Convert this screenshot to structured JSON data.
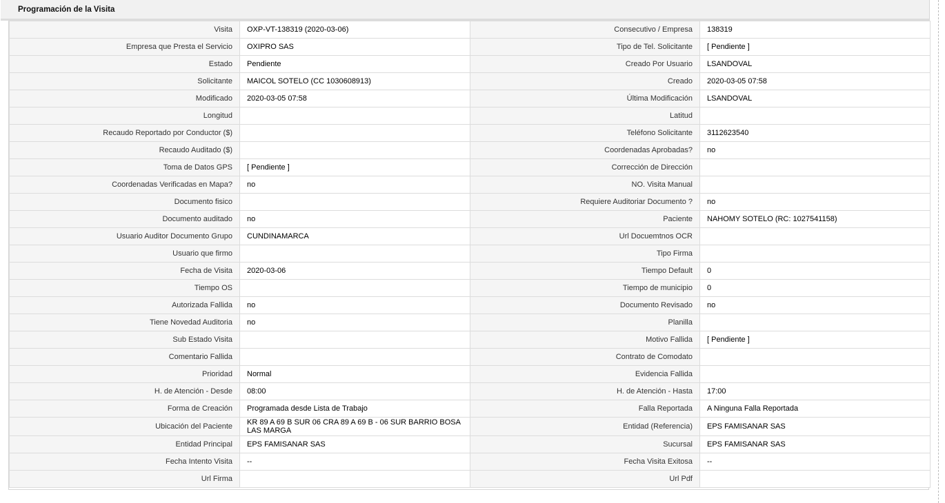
{
  "section_title": "Programación de la Visita",
  "rows": [
    {
      "l1": "Visita",
      "v1": "OXP-VT-138319 (2020-03-06)",
      "l2": "Consecutivo / Empresa",
      "v2": "138319"
    },
    {
      "l1": "Empresa que Presta el Servicio",
      "v1": "OXIPRO SAS",
      "l2": "Tipo de Tel. Solicitante",
      "v2": "[ Pendiente ]"
    },
    {
      "l1": "Estado",
      "v1": "Pendiente",
      "l2": "Creado Por Usuario",
      "v2": "LSANDOVAL"
    },
    {
      "l1": "Solicitante",
      "v1": "MAICOL SOTELO (CC 1030608913)",
      "l2": "Creado",
      "v2": "2020-03-05 07:58"
    },
    {
      "l1": "Modificado",
      "v1": "2020-03-05 07:58",
      "l2": "Última Modificación",
      "v2": " LSANDOVAL"
    },
    {
      "l1": "Longitud",
      "v1": "",
      "l2": "Latitud",
      "v2": ""
    },
    {
      "l1": "Recaudo Reportado por Conductor ($)",
      "v1": "",
      "l2": "Teléfono Solicitante",
      "v2": "3112623540"
    },
    {
      "l1": "Recaudo Auditado ($)",
      "v1": "",
      "l2": "Coordenadas Aprobadas?",
      "v2": " no"
    },
    {
      "l1": "Toma de Datos GPS",
      "v1": "[ Pendiente ]",
      "l2": "Corrección de Dirección",
      "v2": ""
    },
    {
      "l1": "Coordenadas Verificadas en Mapa?",
      "v1": " no",
      "l2": "NO. Visita Manual",
      "v2": ""
    },
    {
      "l1": "Documento fisico",
      "v1": "",
      "l2": "Requiere Auditoriar Documento ?",
      "v2": " no"
    },
    {
      "l1": "Documento auditado",
      "v1": " no",
      "l2": "Paciente",
      "v2": "NAHOMY SOTELO (RC: 1027541158)"
    },
    {
      "l1": "Usuario Auditor Documento Grupo",
      "v1": "CUNDINAMARCA",
      "l2": "Url Docuemtnos OCR",
      "v2": ""
    },
    {
      "l1": "Usuario que firmo",
      "v1": "",
      "l2": "Tipo Firma",
      "v2": ""
    },
    {
      "l1": "Fecha de Visita",
      "v1": " 2020-03-06",
      "l2": "Tiempo Default",
      "v2": "0"
    },
    {
      "l1": "Tiempo OS",
      "v1": "",
      "l2": "Tiempo de municipio",
      "v2": "0"
    },
    {
      "l1": "Autorizada Fallida",
      "v1": " no",
      "l2": "Documento Revisado",
      "v2": " no"
    },
    {
      "l1": "Tiene Novedad Auditoria",
      "v1": " no",
      "l2": "Planilla",
      "v2": ""
    },
    {
      "l1": "Sub Estado Visita",
      "v1": "",
      "l2": "Motivo Fallida",
      "v2": "[ Pendiente ]"
    },
    {
      "l1": "Comentario Fallida",
      "v1": "",
      "l2": "Contrato de Comodato",
      "v2": ""
    },
    {
      "l1": "Prioridad",
      "v1": "Normal",
      "l2": "Evidencia Fallida",
      "v2": ""
    },
    {
      "l1": "H. de Atención - Desde",
      "v1": "08:00",
      "l2": "H. de Atención - Hasta",
      "v2": "17:00"
    },
    {
      "l1": "Forma de Creación",
      "v1": "Programada desde Lista de Trabajo",
      "l2": "Falla Reportada",
      "v2": "A Ninguna Falla Reportada"
    },
    {
      "l1": "Ubicación del Paciente",
      "v1": "KR 89 A 69 B SUR 06 CRA 89 A 69 B - 06 SUR BARRIO BOSA LAS MARGA",
      "l2": "Entidad (Referencia)",
      "v2": "EPS FAMISANAR SAS"
    },
    {
      "l1": "Entidad Principal",
      "v1": "EPS FAMISANAR SAS",
      "l2": "Sucursal",
      "v2": "EPS FAMISANAR SAS"
    },
    {
      "l1": "Fecha Intento Visita",
      "v1": " --",
      "l2": "Fecha Visita Exitosa",
      "v2": " --"
    },
    {
      "l1": "Url Firma",
      "v1": "",
      "l2": "Url Pdf",
      "v2": ""
    }
  ]
}
